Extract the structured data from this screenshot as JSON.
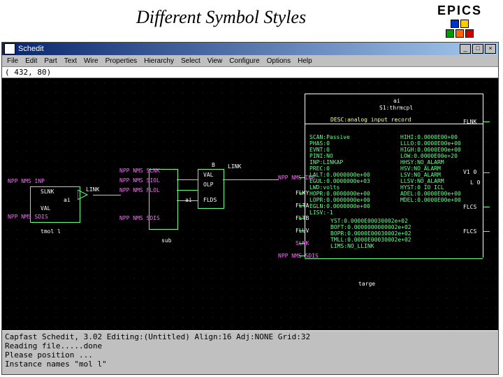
{
  "slide": {
    "title": "Different Symbol Styles"
  },
  "logo": {
    "text": "EPICS"
  },
  "window": {
    "title": "Schedit",
    "menu": [
      "File",
      "Edit",
      "Part",
      "Text",
      "Wire",
      "Properties",
      "Hierarchy",
      "Select",
      "View",
      "Configure",
      "Options",
      "Help"
    ],
    "coord": "( 432,  80)"
  },
  "canvas": {
    "t1": "ai",
    "t2": "S1:thrmcpl",
    "desc": "DESC:analog input record",
    "pin_inp": "NPP NMS INP",
    "pin_flky": "FLKY",
    "pin_flta": "FLTA",
    "pin_fltb": "FLTB",
    "pin_fluv": "FLUV",
    "pin_slnk2": "SLNK",
    "pin_sdis2": "NPP NMS SDIS",
    "tgt": "targe",
    "left_nmnms_inp": "NPP NMS INP",
    "left_slnk": "SLNK",
    "left_val": "VAL",
    "left_nmnms_sdis": "NPP NMS SDIS",
    "left_ai": "ai",
    "left_tmol": "tmol l",
    "link": "LINK",
    "mid_nmnms_slnk": "NPP NMS SLNK",
    "mid_nmnms_siol": "NPP NMS SIOL",
    "mid_nmnms_flol": "NPP NMS FLOL",
    "mid_nmnms_sdis": "NPP NMS SDIS",
    "mid_b": "B",
    "mid_val": "VAL",
    "mid_olp": "OLP",
    "mid_flds": "FLDS",
    "mid_ai": "ai",
    "sub": "sub",
    "link2": "LINK",
    "props_col1": [
      "SCAN:Passive",
      "PHAS:0",
      "EVNT:0",
      "PINI:NO",
      "INP:LINKAP",
      "PREC:0",
      "LALT:0.0000000e+00",
      "EGUL:0.0000000e+03",
      "LWD:volts",
      "HOPR:0.0000000e+00",
      "LOPR:0.0000000e+00",
      "EGLN:0.0000000e+00",
      "LISV:-1"
    ],
    "props_col2": [
      "HIHI:0.0000E00+00",
      "LLLO:0.0000E00e+00",
      "HIGH:0.0000E00e+00",
      "LOW:0.0000E00e+20",
      "HHSY:NO_ALARM",
      "HSV:NO_ALARM",
      "LSV:NO_ALARM",
      "LLSV:NO_ALARM",
      "HYST:0 IO ICL",
      "ADEL:0.0000E00e+00",
      "MDEL:0.0000E00e+00"
    ],
    "props_lower": [
      "YST:0.0000E00030002e+02",
      "BOFT:0.0000000000002e+02",
      "BOPR:0.0000E00030002e+02",
      "TMLL:0.0000E00030002e+02",
      "LIMS:NO_LLINK"
    ],
    "right_pins": {
      "flnk": "FLNK",
      "v1_0": "V1  0",
      "l_0": "L  0",
      "flcs": "FLCS",
      "flcs2": "FLCS"
    }
  },
  "status": {
    "line1": "Capfast Schedit, 3.02 Editing:(Untitled)     Align:16    Adj:NONE    Grid:32",
    "line2": "Reading file.....done",
    "line3": "Please position ...",
    "line4": "Instance names \"mol l\""
  }
}
